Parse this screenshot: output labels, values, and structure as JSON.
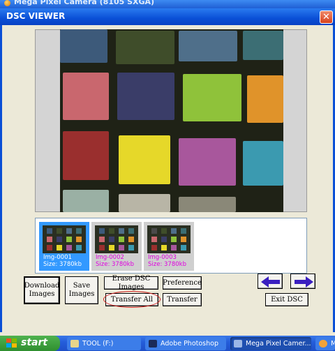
{
  "background_window": {
    "title": "Mega Pixel Camera (8105 SXGA)"
  },
  "dialog": {
    "title": "DSC VIEWER",
    "close_glyph": "✕"
  },
  "thumbnails": [
    {
      "name": "Img-0001",
      "size": "Size: 3780kb",
      "selected": true
    },
    {
      "name": "Img-0002",
      "size": "Size: 3780kb",
      "selected": false
    },
    {
      "name": "Img-0003",
      "size": "Size: 3780kb",
      "selected": false
    }
  ],
  "buttons": {
    "download_images": "Download Images",
    "save_images": "Save Images",
    "erase_dsc_images": "Erase DSC Images",
    "transfer_all": "Transfer All",
    "preference": "Preference",
    "transfer": "Transfer",
    "exit_dsc": "Exit DSC"
  },
  "nav": {
    "prev_icon": "left-arrow-icon",
    "next_icon": "right-arrow-icon",
    "arrow_color": "#3a1fc0"
  },
  "highlight_color": "#d42020",
  "taskbar": {
    "start_label": "start",
    "items": [
      {
        "label": "TOOL (F:)",
        "icon": "folder-icon"
      },
      {
        "label": "Adobe Photoshop",
        "icon": "photoshop-icon"
      },
      {
        "label": "Mega Pixel Camer...",
        "icon": "camera-icon"
      },
      {
        "label": "M",
        "icon": "app-icon"
      }
    ]
  }
}
